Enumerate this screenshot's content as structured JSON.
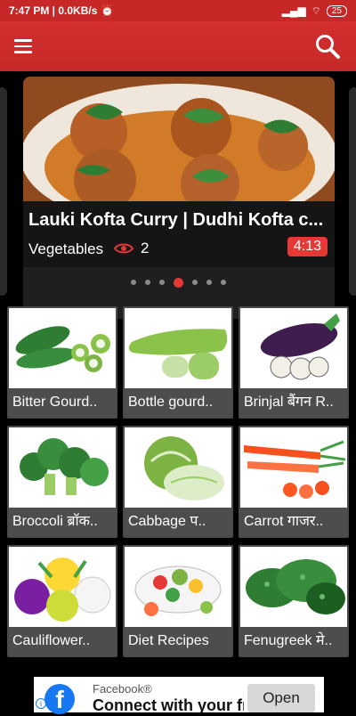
{
  "status_bar": {
    "time_speed": "7:47 PM | 0.0KB/s",
    "battery": "25"
  },
  "toolbar": {
    "menu_icon": "hamburger-menu-icon",
    "search_icon": "search-icon",
    "color": "#c62828"
  },
  "featured": {
    "title": "Lauki Kofta Curry |  Dudhi Kofta c...",
    "category": "Vegetables",
    "views": "2",
    "duration": "4:13",
    "dots_total": 7,
    "active_dot": 4
  },
  "categories": [
    {
      "label": "Bitter Gourd.."
    },
    {
      "label": "Bottle gourd.."
    },
    {
      "label": "Brinjal बैंगन R.."
    },
    {
      "label": "Broccoli ब्रॉक.."
    },
    {
      "label": "Cabbage प.."
    },
    {
      "label": "Carrot गाजर.."
    },
    {
      "label": "Cauliflower.."
    },
    {
      "label": "Diet Recipes"
    },
    {
      "label": "Fenugreek मे.."
    }
  ],
  "ad": {
    "advertiser": "Facebook®",
    "headline": "Connect with your fr",
    "cta": "Open"
  }
}
